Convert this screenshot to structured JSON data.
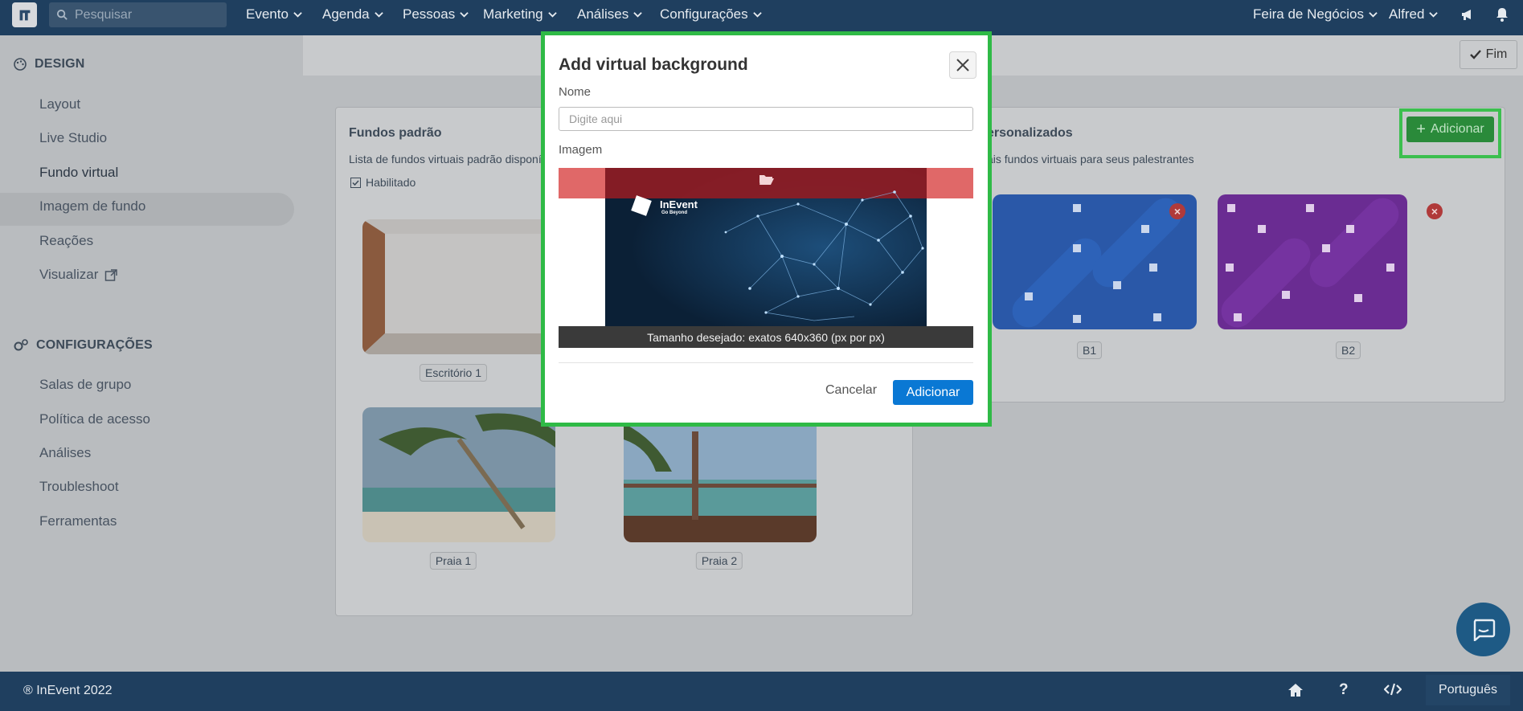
{
  "topbar": {
    "search_placeholder": "Pesquisar",
    "nav": [
      "Evento",
      "Agenda",
      "Pessoas",
      "Marketing",
      "Análises",
      "Configurações"
    ],
    "event_selector": "Feira de Negócios",
    "user": "Alfred"
  },
  "sidebar": {
    "design_title": "DESIGN",
    "design_items": [
      "Layout",
      "Live Studio",
      "Fundo virtual",
      "Imagem de fundo",
      "Reações",
      "Visualizar"
    ],
    "config_title": "CONFIGURAÇÕES",
    "config_items": [
      "Salas de grupo",
      "Política de acesso",
      "Análises",
      "Troubleshoot",
      "Ferramentas"
    ]
  },
  "main": {
    "done_label": "Fim",
    "default_card": {
      "title": "Fundos padrão",
      "description": "Lista de fundos virtuais padrão disponíve",
      "enabled_label": "Habilitado",
      "thumbnails": [
        "Escritório 1",
        "Praia 1",
        "Praia 2"
      ]
    },
    "custom_card": {
      "title": "ersonalizados",
      "description": "ais fundos virtuais para seus palestrantes",
      "add_label": "Adicionar",
      "thumbnails": [
        "B1",
        "B2"
      ]
    }
  },
  "modal": {
    "title": "Add virtual background",
    "name_label": "Nome",
    "name_placeholder": "Digite aqui",
    "image_label": "Imagem",
    "size_hint": "Tamanho desejado: exatos 640x360 (px por px)",
    "logo_text": "InEvent",
    "logo_tagline": "Go Beyond",
    "cancel_label": "Cancelar",
    "confirm_label": "Adicionar"
  },
  "footer": {
    "copyright": "® InEvent 2022",
    "language": "Português"
  },
  "colors": {
    "nav_bg": "#1f3f5f",
    "modal_highlight": "#2fba46",
    "primary_button": "#0a78d4",
    "upload_bar": "#e06868"
  }
}
